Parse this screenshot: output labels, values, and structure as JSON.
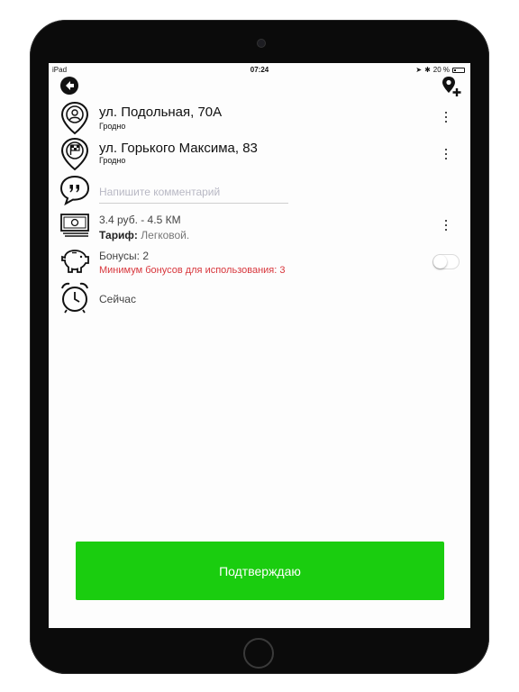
{
  "status_bar": {
    "device": "iPad",
    "time": "07:24",
    "battery": "20 %"
  },
  "route": {
    "from": {
      "address": "ул. Подольная, 70А",
      "city": "Гродно"
    },
    "to": {
      "address": "ул. Горького Максима, 83",
      "city": "Гродно"
    }
  },
  "comment": {
    "placeholder": "Напишите комментарий",
    "value": ""
  },
  "fare": {
    "price": "3.4 руб. - 4.5 КМ",
    "tariff_label": "Тариф:",
    "tariff_value": "Легковой."
  },
  "bonus": {
    "label": "Бонусы: 2",
    "minimum_note": "Минимум бонусов для использования: 3",
    "enabled": false
  },
  "schedule": {
    "label": "Сейчас"
  },
  "confirm_button": {
    "label": "Подтверждаю"
  },
  "colors": {
    "accent": "#1acd0f",
    "warning": "#d8363c",
    "text": "#111111",
    "placeholder": "#b8b8c4"
  }
}
